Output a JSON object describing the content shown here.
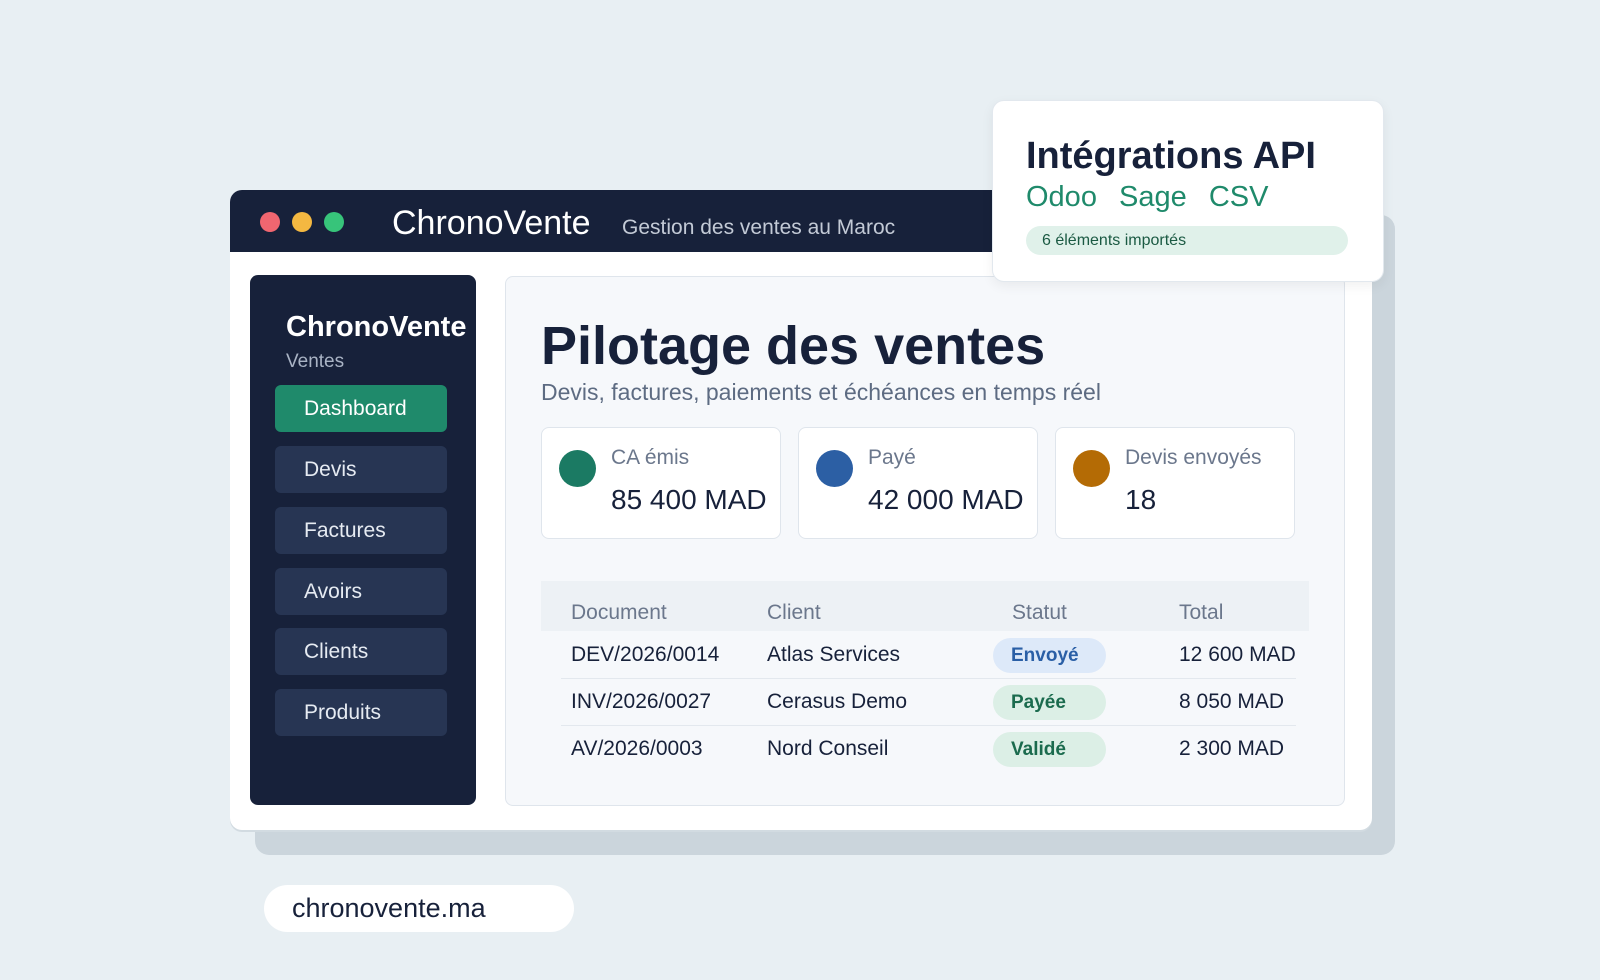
{
  "window": {
    "title": "ChronoVente",
    "subtitle": "Gestion des ventes au Maroc"
  },
  "sidebar": {
    "brand": "ChronoVente",
    "section": "Ventes",
    "items": [
      {
        "label": "Dashboard",
        "active": true
      },
      {
        "label": "Devis"
      },
      {
        "label": "Factures"
      },
      {
        "label": "Avoirs"
      },
      {
        "label": "Clients"
      },
      {
        "label": "Produits"
      }
    ]
  },
  "main": {
    "title": "Pilotage des ventes",
    "subtitle": "Devis, factures, paiements et échéances en temps réel",
    "cards": [
      {
        "label": "CA émis",
        "value": "85 400 MAD",
        "color": "#1b7a63"
      },
      {
        "label": "Payé",
        "value": "42 000 MAD",
        "color": "#2c5fa4"
      },
      {
        "label": "Devis envoyés",
        "value": "18",
        "color": "#b46b05"
      }
    ],
    "table": {
      "headers": [
        "Document",
        "Client",
        "Statut",
        "Total"
      ],
      "rows": [
        {
          "document": "DEV/2026/0014",
          "client": "Atlas Services",
          "status": "Envoyé",
          "total": "12 600 MAD"
        },
        {
          "document": "INV/2026/0027",
          "client": "Cerasus Demo",
          "status": "Payée",
          "total": "8 050 MAD"
        },
        {
          "document": "AV/2026/0003",
          "client": "Nord Conseil",
          "status": "Validé",
          "total": "2 300 MAD"
        }
      ]
    }
  },
  "integrations": {
    "title": "Intégrations API",
    "links": [
      "Odoo",
      "Sage",
      "CSV"
    ],
    "status": "6 éléments importés"
  },
  "website": "chronovente.ma",
  "colors": {
    "navy": "#17213a",
    "accent": "#1f8a6b",
    "background": "#e8eff3"
  }
}
